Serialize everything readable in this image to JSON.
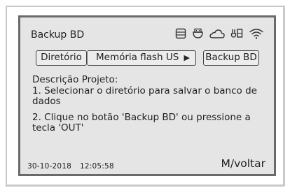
{
  "header": {
    "title": "Backup BD",
    "icons": [
      "storage-icon",
      "usb-device-icon",
      "cloud-icon",
      "ethernet-icon",
      "wifi-icon"
    ]
  },
  "nav": {
    "directory_label": "Diretório",
    "location_value": "Memória flash US",
    "location_arrow": "▶",
    "backup_label": "Backup BD"
  },
  "description": {
    "heading": "Descrição Projeto:",
    "step1": "1. Selecionar o diretório para salvar o banco de dados",
    "step2": "2. Clique no botão 'Backup BD' ou pressione a tecla 'OUT'"
  },
  "footer": {
    "date": "30-10-2018",
    "time": "12:05:58",
    "back_label": "M/voltar"
  }
}
